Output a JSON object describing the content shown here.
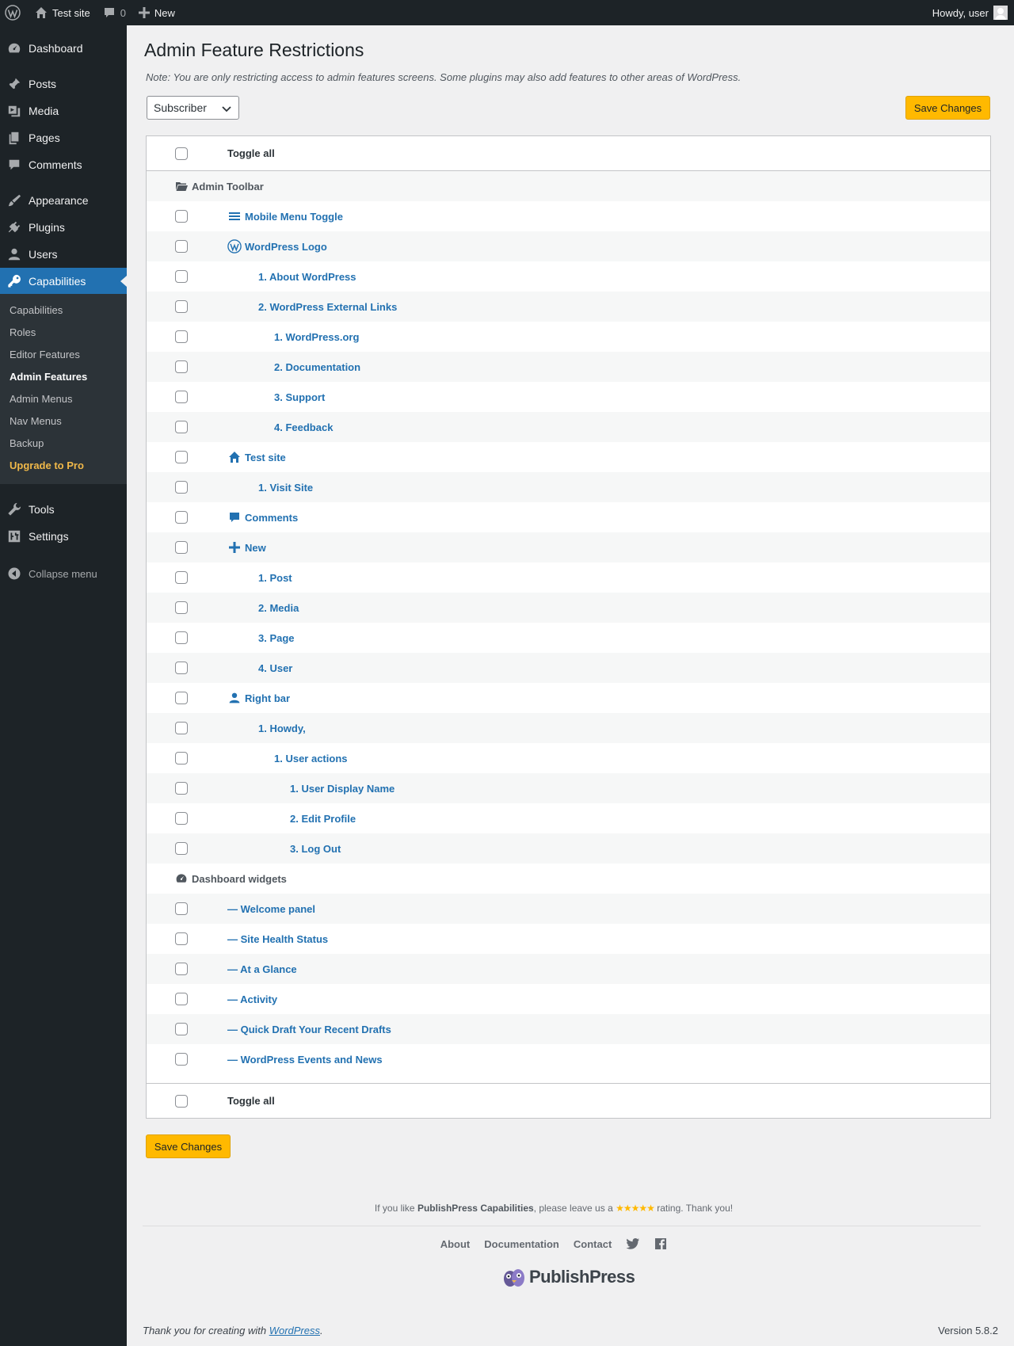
{
  "adminbar": {
    "site_name": "Test site",
    "comments_count": "0",
    "new_label": "New",
    "howdy": "Howdy, user"
  },
  "sidebar": {
    "items": [
      {
        "label": "Dashboard",
        "icon": "dashboard-icon"
      },
      {
        "label": "Posts",
        "icon": "pin-icon"
      },
      {
        "label": "Media",
        "icon": "media-icon"
      },
      {
        "label": "Pages",
        "icon": "pages-icon"
      },
      {
        "label": "Comments",
        "icon": "comment-icon"
      },
      {
        "label": "Appearance",
        "icon": "brush-icon"
      },
      {
        "label": "Plugins",
        "icon": "plugin-icon"
      },
      {
        "label": "Users",
        "icon": "user-icon"
      },
      {
        "label": "Capabilities",
        "icon": "key-icon"
      },
      {
        "label": "Tools",
        "icon": "wrench-icon"
      },
      {
        "label": "Settings",
        "icon": "settings-icon"
      }
    ],
    "submenu": [
      "Capabilities",
      "Roles",
      "Editor Features",
      "Admin Features",
      "Admin Menus",
      "Nav Menus",
      "Backup",
      "Upgrade to Pro"
    ],
    "collapse_label": "Collapse menu"
  },
  "main": {
    "title": "Admin Feature Restrictions",
    "note": "Note: You are only restricting access to admin features screens. Some plugins may also add features to other areas of WordPress.",
    "role_selected": "Subscriber",
    "save_label": "Save Changes",
    "toggle_all": "Toggle all",
    "sections": {
      "toolbar": "Admin Toolbar",
      "widgets": "Dashboard widgets"
    },
    "rows": [
      "Mobile Menu Toggle",
      "WordPress Logo",
      "1. About WordPress",
      "2. WordPress External Links",
      "1. WordPress.org",
      "2. Documentation",
      "3. Support",
      "4. Feedback",
      "Test site",
      "1. Visit Site",
      "Comments",
      "New",
      "1. Post",
      "2. Media",
      "3. Page",
      "4. User",
      "Right bar",
      "1. Howdy,",
      "1. User actions",
      "1. User Display Name",
      "2. Edit Profile",
      "3. Log Out"
    ],
    "widget_rows": [
      "— Welcome panel",
      "— Site Health Status",
      "— At a Glance",
      "— Activity",
      "— Quick Draft Your Recent Drafts",
      "— WordPress Events and News"
    ]
  },
  "footer": {
    "rating_prefix": "If you like",
    "rating_product": "PublishPress Capabilities",
    "rating_mid": ", please leave us a",
    "stars": "★★★★★",
    "rating_suffix": "rating. Thank you!",
    "links": [
      "About",
      "Documentation",
      "Contact"
    ],
    "brand": "PublishPress",
    "thanks_prefix": "Thank you for creating with",
    "thanks_link": "WordPress",
    "thanks_suffix": ".",
    "version": "Version 5.8.2"
  },
  "colors": {
    "admin_dark": "#1d2327",
    "accent_blue": "#2271b1",
    "save_yellow": "#ffb900",
    "upgrade_gold": "#f0b849"
  }
}
